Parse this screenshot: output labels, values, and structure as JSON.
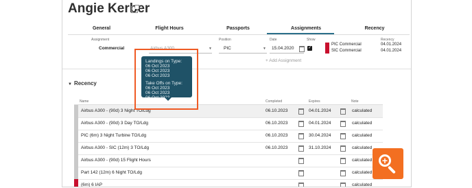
{
  "profile": {
    "name": "Angie Kerber"
  },
  "tabs": [
    "General",
    "Flight Hours",
    "Passports",
    "Assignments",
    "Recency"
  ],
  "assignment": {
    "headers": {
      "assignment": "Assignment",
      "position": "Position",
      "date": "Date",
      "show": "Show",
      "recency": "Recency"
    },
    "row": {
      "assignment": "Commercial",
      "type": "Airbus A300",
      "position": "PIC",
      "date": "15.04.2020"
    },
    "recency_items": [
      {
        "name": "PIC Commercial",
        "date": "04.01.2024"
      },
      {
        "name": "SIC Commercial",
        "date": "04.01.2024"
      }
    ],
    "add_label": "+ Add Assignment"
  },
  "tooltip": {
    "landings_title": "Landings on Type:",
    "landings": [
      "06 Oct 2023",
      "06 Oct 2023",
      "06 Oct 2023"
    ],
    "takeoffs_title": "Take Offs on Type:",
    "takeoffs": [
      "06 Oct 2023",
      "06 Oct 2023",
      "06 Oct 2023"
    ]
  },
  "recency": {
    "section_title": "Recency",
    "columns": {
      "name": "Name",
      "completed": "Completed",
      "expires": "Expires",
      "note": "Note"
    },
    "rows": [
      {
        "name": "Airbus A300 - (90d) 3 Night TO/Ldg",
        "completed": "06.10.2023",
        "expires": "04.01.2024",
        "note": "calculated",
        "status": "ok"
      },
      {
        "name": "Airbus A300 - (90d) 3 Day TO/Ldg",
        "completed": "06.10.2023",
        "expires": "04.01.2024",
        "note": "calculated",
        "status": "ok"
      },
      {
        "name": "PIC (6m) 3 Night Turbine TO/Ldg",
        "completed": "06.10.2023",
        "expires": "30.04.2024",
        "note": "calculated",
        "status": "ok"
      },
      {
        "name": "Airbus A300 - SIC (12m) 3 TO/Ldg",
        "completed": "06.10.2023",
        "expires": "31.10.2024",
        "note": "calculated",
        "status": "ok"
      },
      {
        "name": "Airbus A300 - (90d) 15 Flight Hours",
        "completed": "",
        "expires": "",
        "note": "calculated",
        "status": "ok"
      },
      {
        "name": "Part 142 (12m) 6 Night TO/Ldg",
        "completed": "",
        "expires": "",
        "note": "calculated",
        "status": "ok"
      },
      {
        "name": "(6m) 6 IAP",
        "completed": "",
        "expires": "",
        "note": "calculated",
        "status": "expired"
      }
    ]
  },
  "colors": {
    "accent": "#1f5267",
    "highlight": "#ef5a24",
    "expired": "#c8102e",
    "zoom": "#f36f21"
  },
  "icons": [
    "external-link-icon",
    "calendar-icon",
    "checkbox-icon",
    "chevron-down-icon",
    "zoom-in-icon"
  ]
}
